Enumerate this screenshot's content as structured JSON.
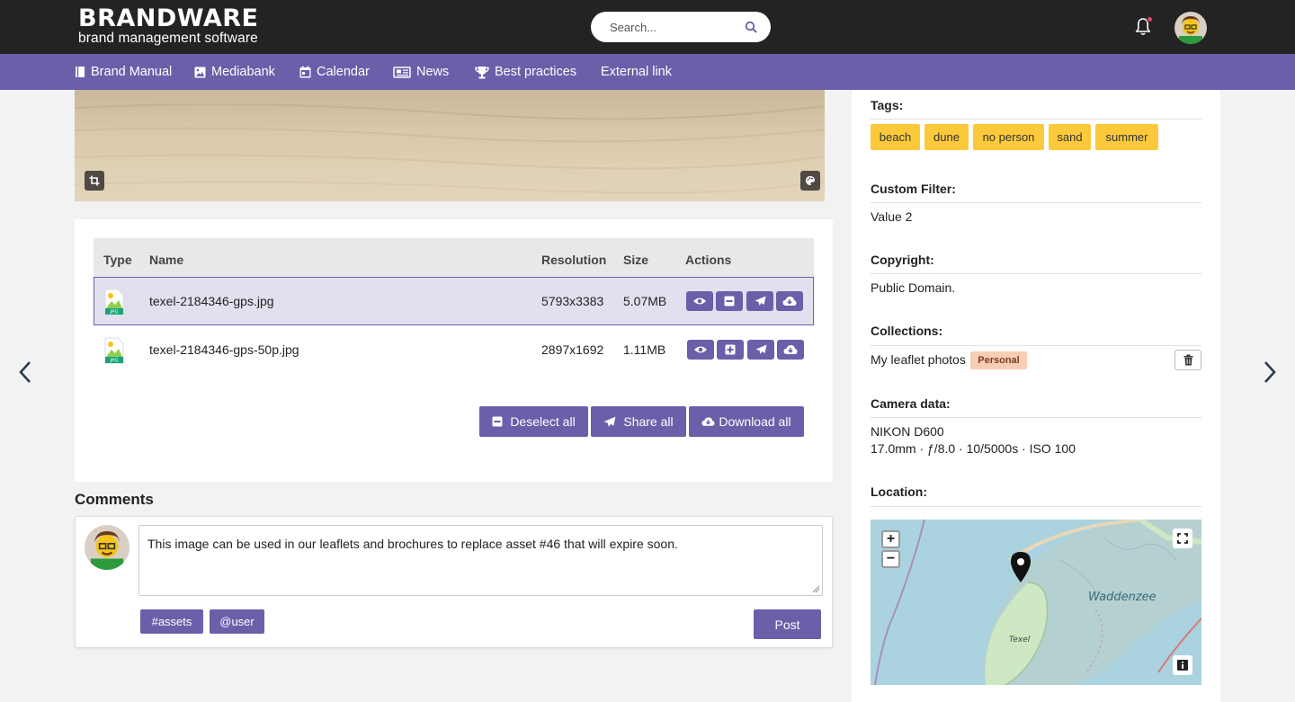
{
  "brand": {
    "name": "BRANDWARE",
    "tagline": "brand management software"
  },
  "search": {
    "placeholder": "Search..."
  },
  "nav": {
    "items": [
      {
        "label": "Brand Manual",
        "icon": "book-icon"
      },
      {
        "label": "Mediabank",
        "icon": "image-icon"
      },
      {
        "label": "Calendar",
        "icon": "calendar-icon"
      },
      {
        "label": "News",
        "icon": "newspaper-icon"
      },
      {
        "label": "Best practices",
        "icon": "trophy-icon"
      },
      {
        "label": "External link",
        "icon": ""
      }
    ]
  },
  "files": {
    "headers": {
      "type": "Type",
      "name": "Name",
      "resolution": "Resolution",
      "size": "Size",
      "actions": "Actions"
    },
    "rows": [
      {
        "type": "JPG",
        "name": "texel-2184346-gps.jpg",
        "resolution": "5793x3383",
        "size": "5.07MB",
        "selected": true
      },
      {
        "type": "JPG",
        "name": "texel-2184346-gps-50p.jpg",
        "resolution": "2897x1692",
        "size": "1.11MB",
        "selected": false
      }
    ],
    "buttons": {
      "deselect_all": "Deselect all",
      "share_all": "Share all",
      "download_all": "Download all"
    }
  },
  "comments": {
    "title": "Comments",
    "text": "This image can be used in our leaflets and brochures to replace asset #46 that will expire soon.",
    "tag_buttons": [
      "#assets",
      "@user"
    ],
    "post_label": "Post"
  },
  "details": {
    "tags_label": "Tags:",
    "tags": [
      "beach",
      "dune",
      "no person",
      "sand",
      "summer"
    ],
    "custom_filter_label": "Custom Filter:",
    "custom_filter_value": "Value 2",
    "copyright_label": "Copyright:",
    "copyright_value": "Public Domain.",
    "collections_label": "Collections:",
    "collection_name": "My leaflet photos",
    "collection_badge": "Personal",
    "camera_label": "Camera data:",
    "camera_model": "NIKON D600",
    "camera_settings": "17.0mm · ƒ/8.0 · 10/5000s · ISO 100",
    "location_label": "Location:",
    "map_labels": {
      "sea": "Waddenzee",
      "island": "Texel"
    }
  },
  "colors": {
    "primary": "#6a5fa8",
    "tag": "#fcc93b",
    "header": "#232323",
    "badge": "#f8cdb5"
  }
}
